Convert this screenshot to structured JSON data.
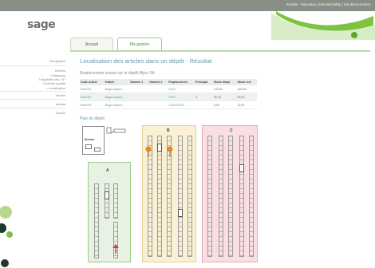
{
  "topbar": {
    "links": [
      "Société : Biprualux",
      "Harrotel Eddy",
      "Ma déconnexion"
    ],
    "separator": " | "
  },
  "logo": "sage",
  "swoosh_text": "Ma sélection",
  "tabs": [
    {
      "label": "Accueil",
      "active": false
    },
    {
      "label": "Ma gestion",
      "active": true
    }
  ],
  "sidebar": {
    "items": [
      {
        "label": "Ma gestion",
        "heading": true
      },
      {
        "label": "Articles",
        "heading": false
      },
      {
        "label": "Catalogue",
        "heading": false
      },
      {
        "label": "Traçabilité lots / N°",
        "heading": false
      },
      {
        "label": "Contrôle qualité",
        "heading": false
      },
      {
        "label": "> Localisation",
        "heading": false
      },
      {
        "label": "Ventes",
        "heading": false
      },
      {
        "label": "Achats",
        "heading": false
      },
      {
        "label": "Stocks",
        "heading": false
      }
    ]
  },
  "page": {
    "title": "Localisation des articles dans un dépôt - Résultat",
    "subtitle": "Emplacement trouvé sur le dépôt Bijou SA",
    "plan_title": "Plan du dépôt"
  },
  "table": {
    "headers": [
      "Code Article",
      "Intitulé",
      "Gamme 1",
      "Gamme 2",
      "Emplacement",
      "Principal",
      "Stock dispo",
      "Stock réel"
    ],
    "rows": [
      [
        "BAAR01",
        "Bague Argent",
        "",
        "",
        "D010",
        "",
        "143,00",
        "146,00"
      ],
      [
        "BAAR01",
        "Bague Argent",
        "",
        "",
        "D002",
        "✔",
        "80,00",
        "85,00"
      ],
      [
        "BAAR01",
        "Bague Argent",
        "",
        "",
        "CONTROLE",
        "",
        "0,00",
        "11,00"
      ]
    ]
  },
  "plan": {
    "legend_label": "Bureau",
    "zones": [
      {
        "label": "A",
        "color": "#e7f2e2",
        "border": "#9ccb8c"
      },
      {
        "label": "B",
        "color": "#fbf0d4",
        "border": "#e7cf95"
      },
      {
        "label": "C",
        "color": "#f9dfe3",
        "border": "#e7a8b2"
      }
    ],
    "marker_colors": {
      "found": "#e58a1e",
      "arrow": "#e23b3b"
    }
  }
}
